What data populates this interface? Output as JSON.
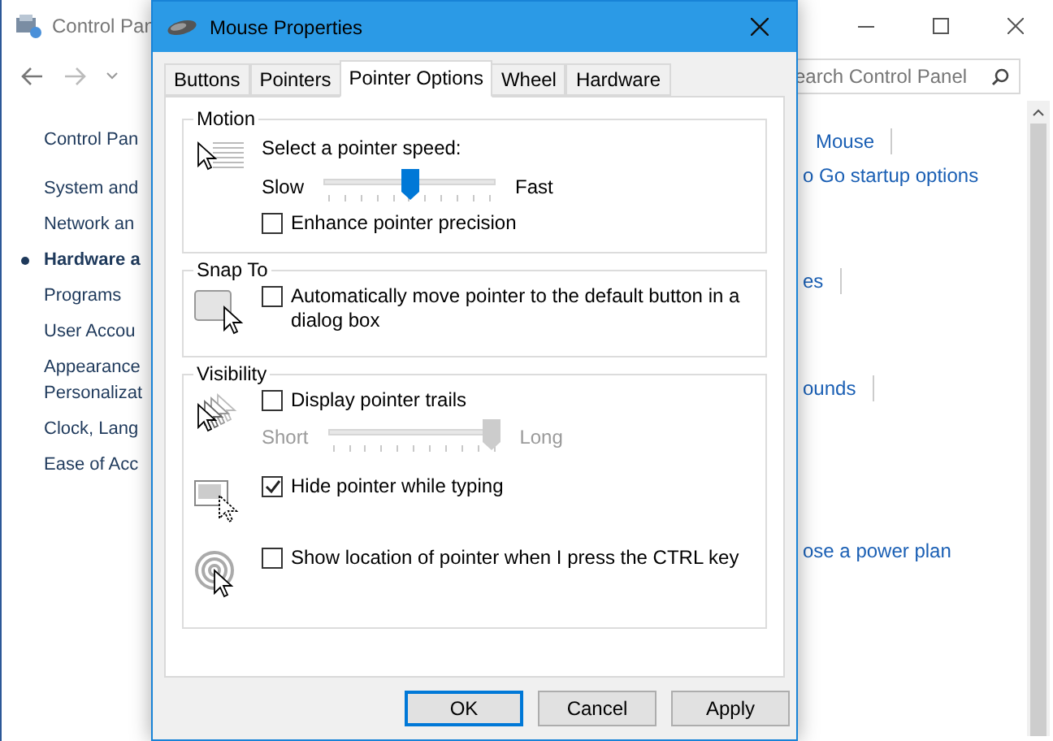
{
  "background_window": {
    "title": "Control Pan",
    "search": {
      "placeholder": "earch Control Panel"
    },
    "sidebar": {
      "items": [
        {
          "lines": [
            "Control Pan"
          ],
          "selected": false
        },
        {
          "lines": [
            "System and"
          ],
          "selected": false
        },
        {
          "lines": [
            "Network an"
          ],
          "selected": false
        },
        {
          "lines": [
            "Hardware a"
          ],
          "selected": true
        },
        {
          "lines": [
            "Programs"
          ],
          "selected": false
        },
        {
          "lines": [
            "User Accou"
          ],
          "selected": false
        },
        {
          "lines": [
            "Appearance",
            "Personalizat"
          ],
          "selected": false
        },
        {
          "lines": [
            "Clock, Lang"
          ],
          "selected": false
        },
        {
          "lines": [
            "Ease of Acc"
          ],
          "selected": false
        }
      ]
    },
    "links": [
      {
        "label": "Mouse",
        "divider": true
      },
      {
        "label": "o Go startup options",
        "divider": false
      },
      {
        "label": "es",
        "divider": true
      },
      {
        "label": "ounds",
        "divider": true
      },
      {
        "label": "ose a power plan",
        "divider": false
      }
    ]
  },
  "dialog": {
    "title": "Mouse Properties",
    "tabs": [
      {
        "label": "Buttons",
        "selected": false
      },
      {
        "label": "Pointers",
        "selected": false
      },
      {
        "label": "Pointer Options",
        "selected": true
      },
      {
        "label": "Wheel",
        "selected": false
      },
      {
        "label": "Hardware",
        "selected": false
      }
    ],
    "groups": [
      {
        "title": "Motion",
        "rows": [
          {
            "items": [
              {
                "kind": "text",
                "label": "Select a pointer speed:"
              },
              {
                "kind": "slider",
                "min_label": "Slow",
                "max_label": "Fast",
                "level": 0.5,
                "disabled": false
              },
              {
                "kind": "checkbox",
                "label": "Enhance pointer precision",
                "checked": false
              }
            ]
          }
        ]
      },
      {
        "title": "Snap To",
        "rows": [
          {
            "items": [
              {
                "kind": "checkbox",
                "label": "Automatically move pointer to the default button in a dialog box",
                "checked": false
              }
            ]
          }
        ]
      },
      {
        "title": "Visibility",
        "rows": [
          {
            "items": [
              {
                "kind": "checkbox",
                "label": "Display pointer trails",
                "checked": false
              },
              {
                "kind": "slider",
                "min_label": "Short",
                "max_label": "Long",
                "level": 1,
                "disabled": true
              }
            ]
          },
          {
            "items": [
              {
                "kind": "checkbox",
                "label": "Hide pointer while typing",
                "checked": true
              }
            ]
          },
          {
            "items": [
              {
                "kind": "checkbox",
                "label": "Show location of pointer when I press the CTRL key",
                "checked": false
              }
            ]
          }
        ]
      }
    ],
    "buttons": [
      {
        "label": "OK",
        "default": true
      },
      {
        "label": "Cancel",
        "default": false
      },
      {
        "label": "Apply",
        "default": false
      }
    ]
  }
}
